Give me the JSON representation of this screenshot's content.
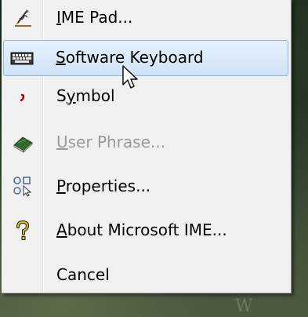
{
  "menu": {
    "items": [
      {
        "label_accel": "I",
        "label_rest": "ME Pad...",
        "icon": "ime-pad-icon",
        "enabled": true,
        "highlighted": false
      },
      {
        "label_accel": "S",
        "label_rest": "oftware Keyboard",
        "icon": "software-keyboard-icon",
        "enabled": true,
        "highlighted": true
      },
      {
        "label_pre": "S",
        "label_accel": "y",
        "label_rest": "mbol",
        "icon": "symbol-icon",
        "enabled": true,
        "highlighted": false
      },
      {
        "label_accel": "U",
        "label_rest": "ser Phrase...",
        "icon": "user-phrase-icon",
        "enabled": false,
        "highlighted": false
      },
      {
        "label_accel": "P",
        "label_rest": "roperties...",
        "icon": "properties-icon",
        "enabled": true,
        "highlighted": false
      },
      {
        "label_accel": "A",
        "label_rest": "bout Microsoft IME...",
        "icon": "help-icon",
        "enabled": true,
        "highlighted": false
      },
      {
        "label": "Cancel",
        "enabled": true,
        "highlighted": false
      }
    ]
  },
  "colors": {
    "menu_background": "#f0f0f0",
    "highlight_border": "#8fb5e0",
    "highlight_fill": "#d9e9f9",
    "disabled_text": "#9a9a9a"
  }
}
